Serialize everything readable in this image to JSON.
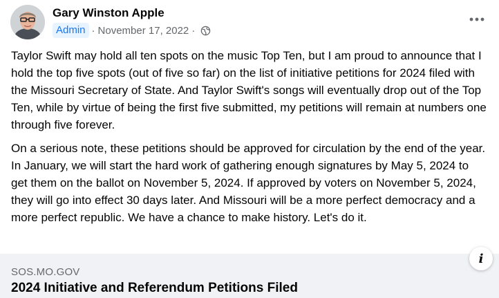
{
  "post": {
    "author": "Gary Winston Apple",
    "role_badge": "Admin",
    "date": "November 17, 2022",
    "separator": "·",
    "privacy_icon": "globe-icon",
    "more_icon": "more-horizontal-icon",
    "paragraphs": [
      "Taylor Swift may hold all ten spots on the music Top Ten, but I am proud to announce that I hold the top five spots (out of five so far) on the list of initiative petitions for 2024 filed with the Missouri Secretary of State.  And Taylor Swift's songs will eventually drop out of the Top Ten, while by virtue of being the first five submitted, my petitions will remain at numbers one through five forever.",
      "On a serious note, these petitions should be approved for circulation by the end of the year.  In January, we will start the hard work of gathering enough signatures by May 5, 2024 to get them on the ballot on November 5, 2024.  If approved by voters on November 5, 2024, they will go into effect 30 days later.  And Missouri will be a more perfect democracy and a more perfect republic.  We have a chance to make history.  Let's do it."
    ]
  },
  "link_preview": {
    "domain": "SOS.MO.GOV",
    "title": "2024 Initiative and Referendum Petitions Filed",
    "info_icon": "info-icon",
    "info_glyph": "i"
  },
  "colors": {
    "text": "#050505",
    "secondary": "#65676b",
    "badge_bg": "#e7f3ff",
    "badge_text": "#1877f2",
    "preview_bg": "#f0f2f5"
  }
}
